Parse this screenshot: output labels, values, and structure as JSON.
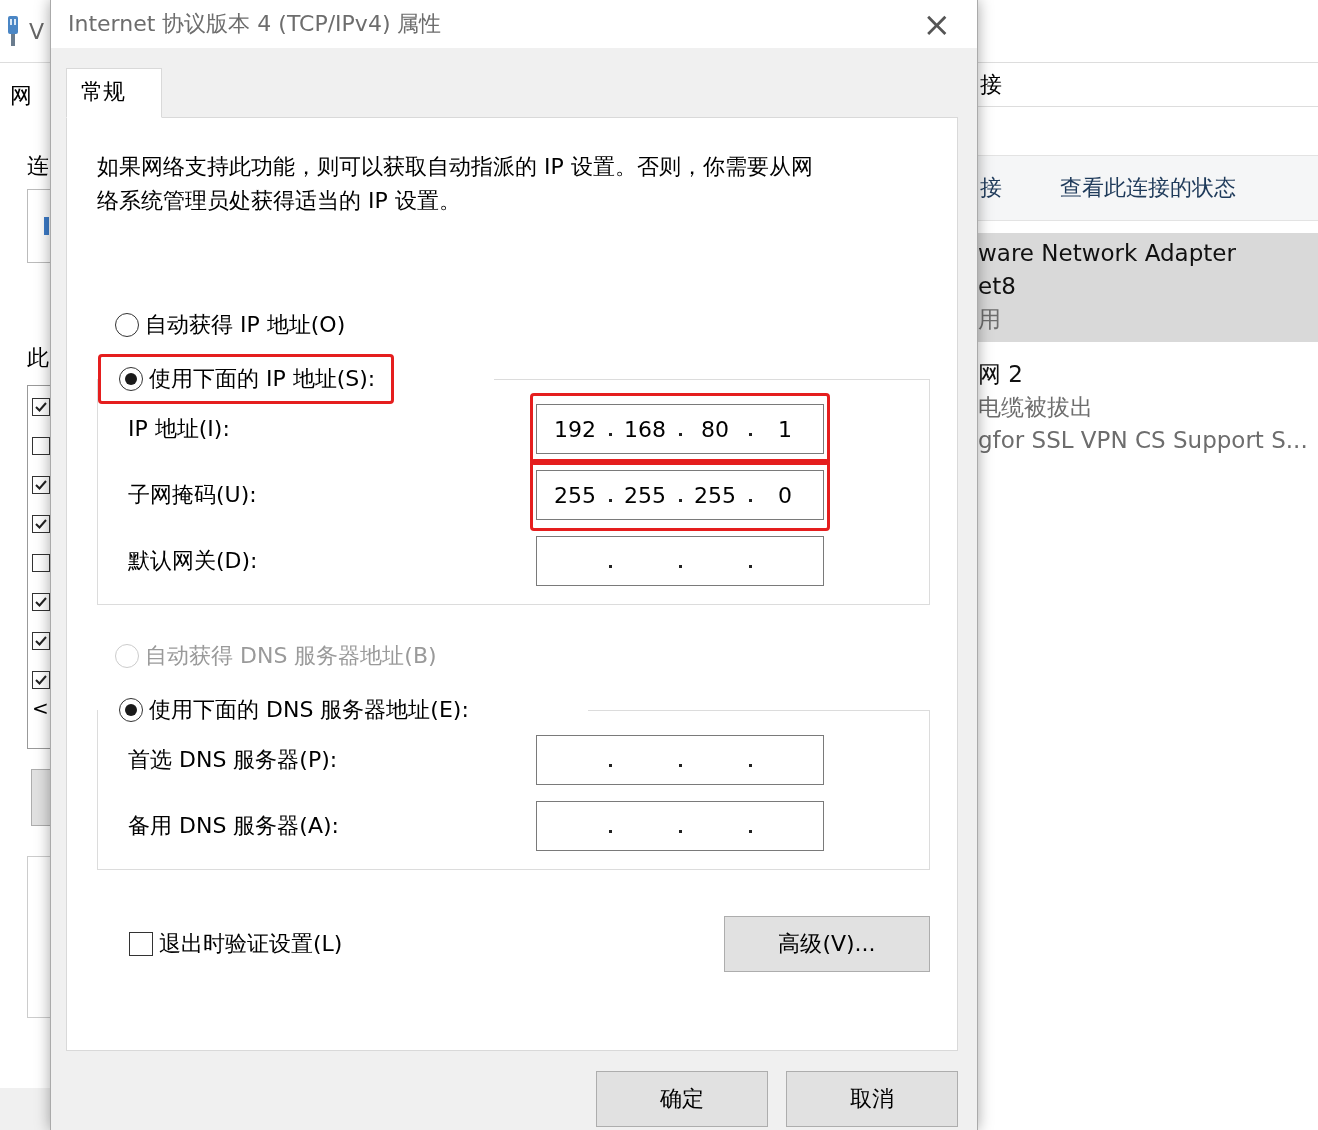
{
  "background_window": {
    "title": "V",
    "left": {
      "tab": "网",
      "label_1": "连",
      "label_2": "此",
      "checkboxes": [
        {
          "checked": true
        },
        {
          "checked": false
        },
        {
          "checked": true
        },
        {
          "checked": true
        },
        {
          "checked": false
        },
        {
          "checked": true
        },
        {
          "checked": true
        },
        {
          "checked": true
        }
      ],
      "scroll_arrow": "<"
    },
    "right": {
      "tab": "接",
      "toolbar": [
        "接",
        "查看此连接的状态"
      ],
      "adapters": [
        {
          "selected": true,
          "lines": [
            "ware Network Adapter",
            "et8",
            "用"
          ]
        },
        {
          "selected": false,
          "lines": [
            "网 2",
            "电缆被拔出",
            "gfor SSL VPN CS Support S..."
          ]
        }
      ]
    }
  },
  "dialog": {
    "title": "Internet 协议版本 4 (TCP/IPv4) 属性",
    "close": "×",
    "tabs": [
      {
        "label": "常规",
        "selected": true
      }
    ],
    "description": "如果网络支持此功能，则可以获取自动指派的 IP 设置。否则，你需要从网络系统管理员处获得适当的 IP 设置。",
    "ip_mode": {
      "options": [
        {
          "label": "自动获得 IP 地址(O)",
          "selected": false,
          "disabled": false,
          "highlighted": false
        },
        {
          "label": "使用下面的 IP 地址(S):",
          "selected": true,
          "disabled": false,
          "highlighted": true
        }
      ],
      "fields": [
        {
          "label": "IP 地址(I):",
          "octets": [
            "192",
            "168",
            "80",
            "1"
          ],
          "highlighted": true
        },
        {
          "label": "子网掩码(U):",
          "octets": [
            "255",
            "255",
            "255",
            "0"
          ],
          "highlighted": true
        },
        {
          "label": "默认网关(D):",
          "highlighted": false
        }
      ]
    },
    "dns_mode": {
      "options": [
        {
          "label": "自动获得 DNS 服务器地址(B)",
          "selected": false,
          "disabled": true,
          "highlighted": false
        },
        {
          "label": "使用下面的 DNS 服务器地址(E):",
          "selected": true,
          "disabled": false,
          "highlighted": false
        }
      ],
      "fields": [
        {
          "label": "首选 DNS 服务器(P):",
          "highlighted": false
        },
        {
          "label": "备用 DNS 服务器(A):",
          "highlighted": false
        }
      ]
    },
    "validate_checkbox": {
      "label": "退出时验证设置(L)",
      "checked": false
    },
    "advanced_button": "高级(V)...",
    "buttons": [
      "确定",
      "取消"
    ]
  }
}
